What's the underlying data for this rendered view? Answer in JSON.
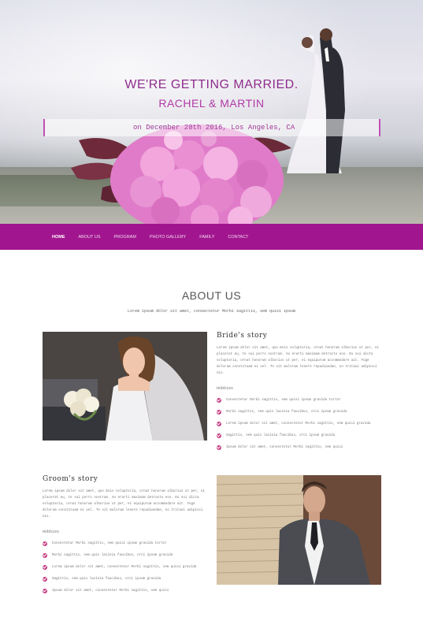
{
  "hero": {
    "line1": "WE'RE GETTING MARRIED.",
    "line2": "RACHEL & MARTIN",
    "date": "on December 28th 2016, Los Angeles, CA"
  },
  "nav": {
    "items": [
      "HOME",
      "ABOUT US",
      "PROGRAM",
      "PHOTO GALLERY",
      "FAMILY",
      "CONTACT"
    ],
    "active": "HOME"
  },
  "about": {
    "title": "ABOUT US",
    "subtitle": "Lorem ipsum dolor sit amet, consectetur Morbi sagittis, sem quisi ipsum"
  },
  "bride": {
    "title": "Bride's story",
    "paragraph": "Lorem ipsum dolor sit amet, quo mois volupturia, ornat honorum alburius ut per, ei placerat eu, te sui porro nostrum. An erarti maximum detracto eos. Eu sui dicta voluptaria, ornat honorum alburius ut per, ei equipurum accommodare ait. Fuge dolorum constituam ei vel. Te sit malorum lenere repudiandae, no tritaui adipisci nis.",
    "hobbies_label": "Hobbies",
    "hobbies": [
      "Consectetur Morbi sagittis, sem quisi ipsum gravida tortor",
      "Morbi sagittis, sem quis lacinia faucibus, orci ipsum gravida",
      "Lorem ipsum dolor sit amet, consectetur Morbi sagittis, sem quisi gravida",
      "Sagittis, sem quis lacinia faucibus, orci ipsum gravida",
      "Ipsum dolor sit amet, consectetur Morbi sagittis, sem quisi"
    ]
  },
  "groom": {
    "title": "Groom's story",
    "paragraph": "Lorem ipsum dolor sit amet, quo mois volupturia, ornat honorum alburius ut per, ei placerat eu, te sui porro nostrum. An erarti maximum detracto eos. Eu sui dicta voluptaria, ornat honorum alburius ut per, ei equipurum accommodare ait. Fuge dolorum constituam ei vel. Te sit malorum lenere repudiandae, no tritaui adipisci nis.",
    "hobbies_label": "Hobbies",
    "hobbies": [
      "Consectetur Morbi sagittis, sem quisi ipsum gravida tortor",
      "Morbi sagittis, sem quis lacinia faucibus, orci ipsum gravida",
      "Lorem ipsum dolor sit amet, consectetur Morbi sagittis, sem quisi gravida",
      "Sagittis, sem quis lacinia faucibus, orci ipsum gravida",
      "Ipsum dolor sit amet, consectetur Morbi sagittis, sem quisi"
    ]
  },
  "colors": {
    "accent": "#a1168f",
    "heading": "#8e2d8c",
    "bullet": "#c53b7f"
  }
}
